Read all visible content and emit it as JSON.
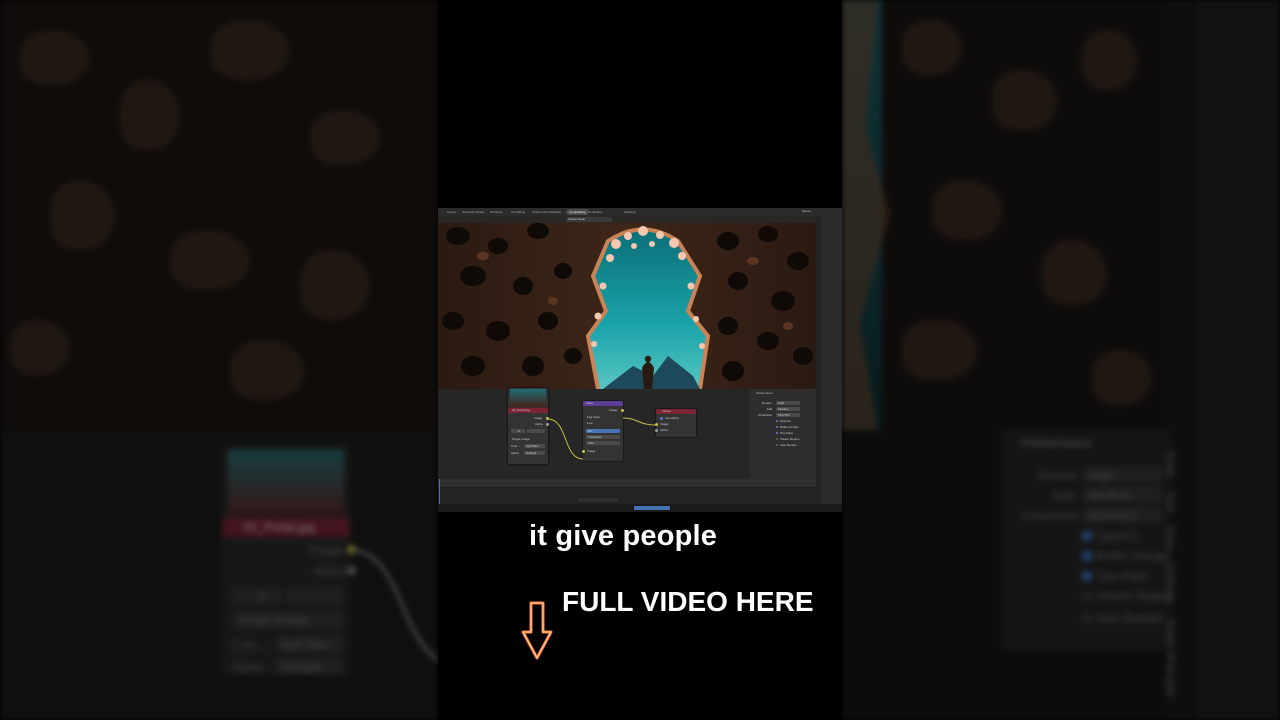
{
  "caption": "it give people",
  "cta": "FULL VIDEO HERE",
  "cta_icon": "down-arrow-icon",
  "colors": {
    "caption_text": "#ffffff",
    "arrow_stroke": "#ff7a2a",
    "accent_blue": "#4772b3",
    "node_header_image": "#7a2435",
    "node_header_color": "#5d3c96"
  },
  "blender": {
    "workspace_tabs": [
      "Layout",
      "Geometry Nodes",
      "Sculpting",
      "UV Editing",
      "Texture Paint",
      "Shading",
      "Animation",
      "Rendering",
      "Compositing",
      "Scripting"
    ],
    "active_tab": "Compositing",
    "scene_label": "Scene",
    "viewer_label": "Viewer Node",
    "image_node": {
      "title": "02_Portal.jpg",
      "outputs": [
        "Image",
        "Alpha"
      ],
      "frame_value": "0",
      "source": "Single Image",
      "color_label": "Colo...",
      "colorspace": "AgX Bas...",
      "alpha_label": "Alpha",
      "alpha_mode": "Straight"
    },
    "mid_node": {
      "title": "Glare",
      "output": "Image",
      "mode": "Fog Glow",
      "quality": "Low",
      "mix": "Mix",
      "threshold": "Threshold",
      "size": "Size",
      "input": "Image"
    },
    "viewer_node": {
      "title": "Viewer",
      "use_alpha": "Use Alpha",
      "input_image": "Image",
      "input_alpha": "Alpha"
    },
    "performance": {
      "title": "Performance",
      "render_label": "Render",
      "render_value": "High",
      "edit_label": "Edit",
      "edit_value": "Medium",
      "chunksize_label": "Chunksize",
      "chunksize_value": "512×512",
      "options": [
        "OpenCL",
        "Buffer Groups",
        "Two Pass",
        "Viewer Region",
        "Auto Render"
      ]
    }
  },
  "background_left": {
    "node_title": "02_Portal.jpg",
    "outputs": [
      "Image",
      "Alpha"
    ],
    "frame_value": "0",
    "source": "Single Image",
    "color_label": "Colo...",
    "colorspace": "AgX Bas...",
    "alpha_label": "Alpha",
    "alpha_mode": "Straight"
  },
  "background_right": {
    "panel_title": "Performance",
    "render_label": "Render",
    "render_value": "High",
    "edit_label": "Edit",
    "edit_value": "Medium",
    "chunksize_label": "Chunksize",
    "chunksize_value": "512×512",
    "options": [
      "OpenCL",
      "Buffer Groups",
      "Two Pass",
      "Viewer Region",
      "Auto Render"
    ],
    "side_tabs": [
      "Node",
      "Tool",
      "View",
      "Options",
      "Node Wrangler"
    ]
  }
}
